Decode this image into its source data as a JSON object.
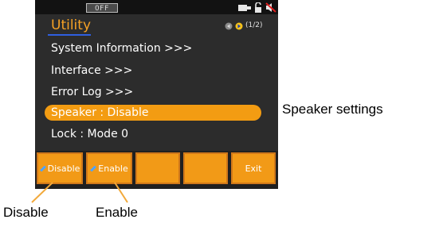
{
  "status_bar": {
    "output_state": "OFF",
    "icons": [
      "battery-plug-icon",
      "unlock-icon",
      "speaker-muted-icon"
    ]
  },
  "screen": {
    "title": "Utility",
    "page_indicator": "(1/2)",
    "menu_items": [
      {
        "label": "System  Information  >>>",
        "selected": false
      },
      {
        "label": "Interface  >>>",
        "selected": false
      },
      {
        "label": "Error  Log  >>>",
        "selected": false
      },
      {
        "label": "Speaker  :  Disable",
        "selected": true
      },
      {
        "label": "Lock  :  Mode  0",
        "selected": false
      }
    ]
  },
  "softkeys": [
    {
      "label": "Disable",
      "icon": "pencil-icon"
    },
    {
      "label": "Enable",
      "icon": "pencil-icon"
    },
    {
      "label": ""
    },
    {
      "label": ""
    },
    {
      "label": "Exit"
    }
  ],
  "annotations": {
    "side": "Speaker settings",
    "disable": "Disable",
    "enable": "Enable"
  },
  "colors": {
    "accent_orange": "#f39c12",
    "title_orange": "#f6a225",
    "screen_bg": "#2c2c2c",
    "underline_blue": "#2f5fe0"
  }
}
